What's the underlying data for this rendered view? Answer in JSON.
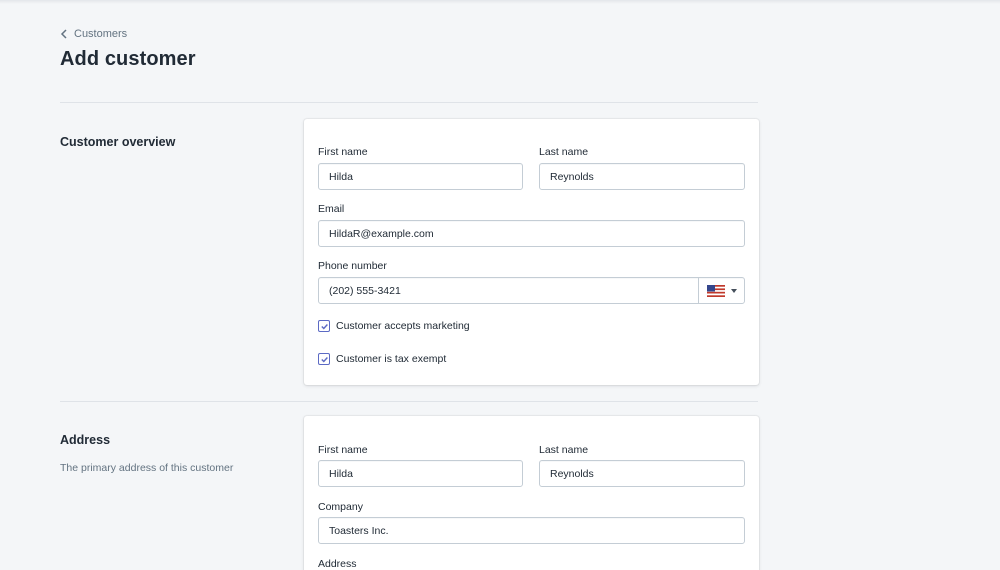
{
  "breadcrumb": {
    "label": "Customers"
  },
  "page": {
    "title": "Add customer"
  },
  "overview": {
    "title": "Customer overview",
    "first_name": {
      "label": "First name",
      "value": "Hilda"
    },
    "last_name": {
      "label": "Last name",
      "value": "Reynolds"
    },
    "email": {
      "label": "Email",
      "value": "HildaR@example.com"
    },
    "phone": {
      "label": "Phone number",
      "value": "(202) 555-3421",
      "country": "US flag"
    },
    "checkboxes": [
      {
        "label": "Customer accepts marketing",
        "checked": true
      },
      {
        "label": "Customer is tax exempt",
        "checked": true
      }
    ]
  },
  "address": {
    "title": "Address",
    "description": "The primary address of this customer",
    "first_name": {
      "label": "First name",
      "value": "Hilda"
    },
    "last_name": {
      "label": "Last name",
      "value": "Reynolds"
    },
    "company": {
      "label": "Company",
      "value": "Toasters Inc."
    },
    "address_label": "Address"
  },
  "colors": {
    "background": "#f4f6f8",
    "card": "#ffffff",
    "text": "#212b36",
    "subdued": "#637381",
    "border": "#c4cdd5",
    "checkbox_accent": "#5c6ac4"
  },
  "icons": [
    "chevron-left-icon",
    "us-flag-icon",
    "caret-down-icon",
    "checkmark-icon"
  ]
}
